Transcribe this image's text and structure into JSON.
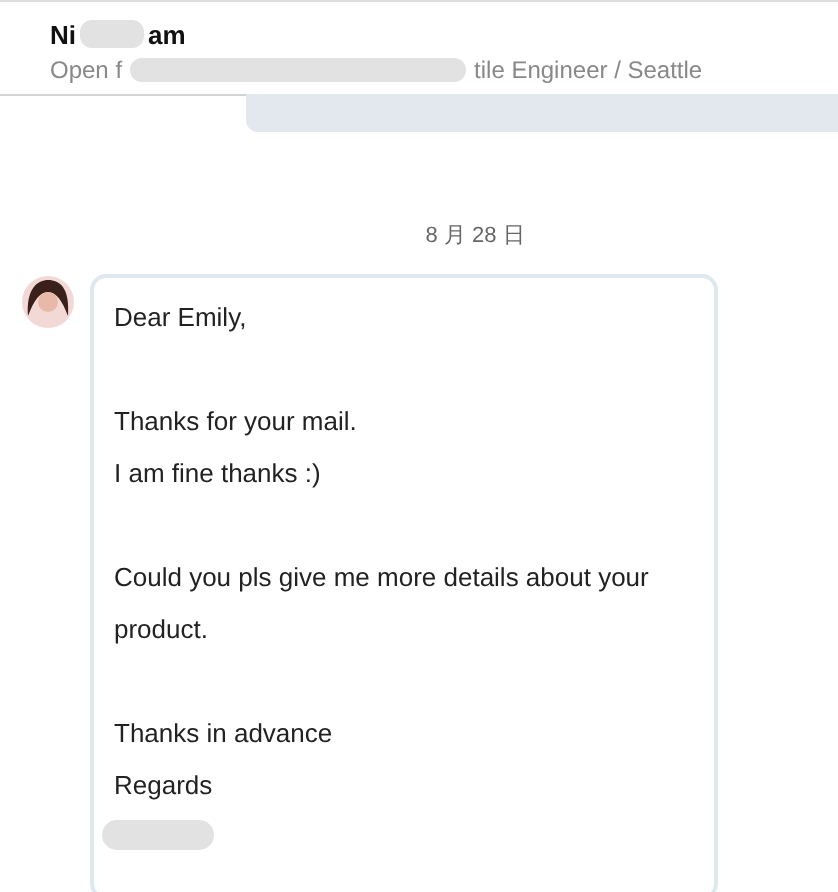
{
  "header": {
    "name_start": "Ni",
    "name_end": "am",
    "headline_start": "Open f",
    "headline_end": "tile Engineer / Seattle"
  },
  "date": "8 月 28 日",
  "message": {
    "paragraphs": [
      [
        "Dear Emily,"
      ],
      [
        "Thanks for your mail.",
        "I am fine thanks :)"
      ],
      [
        "Could you pls give me more details about your product."
      ],
      [
        "Thanks in advance",
        "Regards"
      ]
    ]
  }
}
